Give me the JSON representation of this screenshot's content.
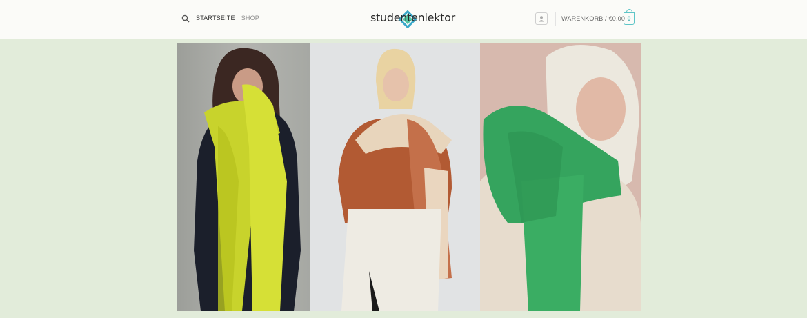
{
  "header": {
    "nav": [
      {
        "label": "STARTSEITE"
      },
      {
        "label": "SHOP"
      }
    ],
    "logo": {
      "text": "studentenlektor"
    },
    "cart": {
      "label": "WARENKORB / €0.00",
      "count": "0"
    }
  },
  "banner": {
    "images": [
      {
        "icon": "woman-yellow-scarf-photo"
      },
      {
        "icon": "woman-rust-scarf-photo"
      },
      {
        "icon": "woman-green-scarf-photo"
      }
    ]
  },
  "colors": {
    "page_background": "#e2ecda",
    "header_background": "#fbfbf8",
    "accent": "#5ec5c7"
  }
}
